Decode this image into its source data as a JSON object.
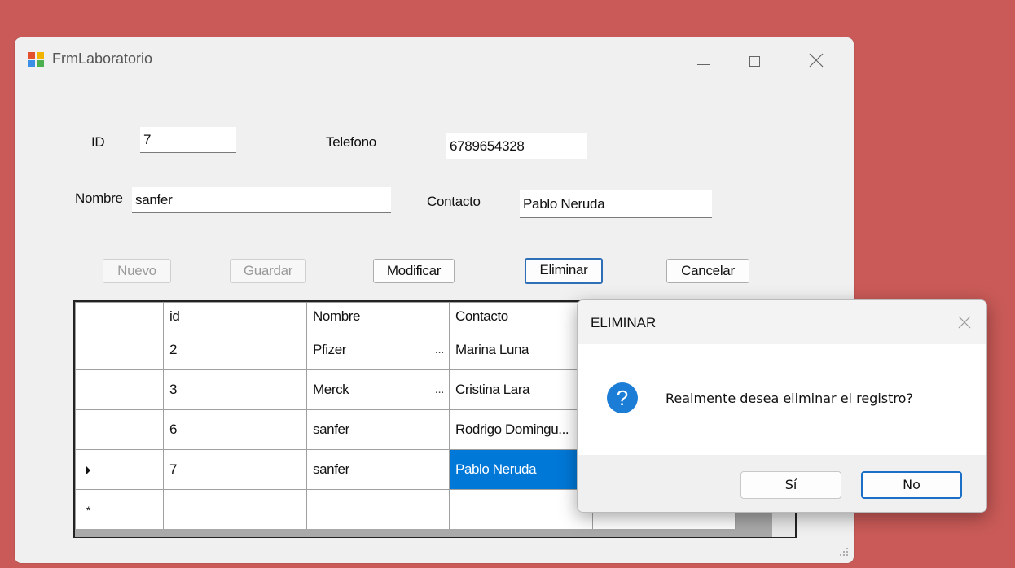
{
  "window": {
    "title": "FrmLaboratorio"
  },
  "form": {
    "id_label": "ID",
    "id_value": "7",
    "telefono_label": "Telefono",
    "telefono_value": "6789654328",
    "nombre_label": "Nombre",
    "nombre_value": "sanfer",
    "contacto_label": "Contacto",
    "contacto_value": "Pablo Neruda"
  },
  "buttons": {
    "nuevo": "Nuevo",
    "guardar": "Guardar",
    "modificar": "Modificar",
    "eliminar": "Eliminar",
    "cancelar": "Cancelar"
  },
  "grid": {
    "columns": [
      "id",
      "Nombre",
      "Contacto"
    ],
    "rows": [
      {
        "id": "2",
        "nombre": "Pfizer",
        "contacto": "Marina Luna"
      },
      {
        "id": "3",
        "nombre": "Merck",
        "contacto": "Cristina Lara"
      },
      {
        "id": "6",
        "nombre": "sanfer",
        "contacto": "Rodrigo Domingu..."
      },
      {
        "id": "7",
        "nombre": "sanfer",
        "contacto": "Pablo Neruda"
      }
    ],
    "current_row_marker": "▶",
    "new_row_marker": "*",
    "ellipsis": "...",
    "selection_color": "#0078d7"
  },
  "dialog": {
    "title": "ELIMINAR",
    "message": "Realmente desea eliminar el registro?",
    "icon": "question-icon",
    "icon_glyph": "?",
    "yes_label": "Sí",
    "no_label": "No"
  },
  "colors": {
    "desktop": "#c95a57",
    "accent": "#1c7dd6"
  }
}
